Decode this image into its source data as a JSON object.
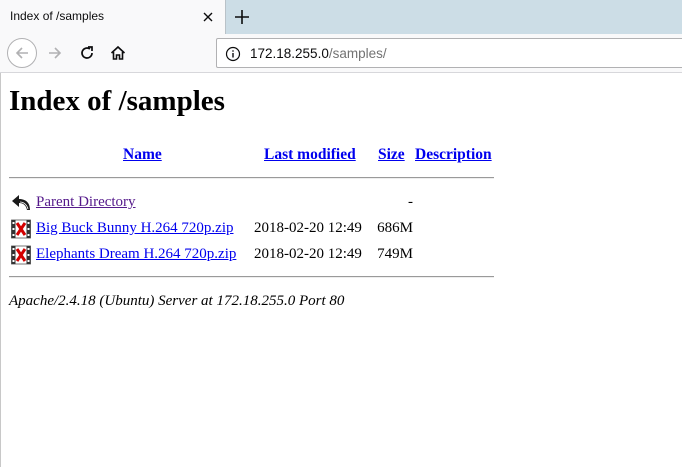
{
  "browser": {
    "tab": {
      "title": "Index of /samples"
    },
    "url": {
      "host": "172.18.255.0",
      "path": "/samples/"
    }
  },
  "page": {
    "title": "Index of /samples",
    "columns": {
      "name": "Name",
      "last_modified": "Last modified",
      "size": "Size",
      "description": "Description"
    },
    "rows": [
      {
        "icon": "back-arrow-icon",
        "name": "Parent Directory",
        "date": "",
        "size": "-",
        "visited": true
      },
      {
        "icon": "video-file-icon",
        "name": "Big Buck Bunny H.264 720p.zip",
        "date": "2018-02-20 12:49",
        "size": "686M",
        "visited": false
      },
      {
        "icon": "video-file-icon",
        "name": "Elephants Dream H.264 720p.zip",
        "date": "2018-02-20 12:49",
        "size": "749M",
        "visited": false
      }
    ],
    "footer": "Apache/2.4.18 (Ubuntu) Server at 172.18.255.0 Port 80"
  },
  "colors": {
    "link": "#0000ee",
    "visited_link": "#551a8b",
    "tabbar": "#ccdde6",
    "toolbar": "#f9f9fa"
  }
}
